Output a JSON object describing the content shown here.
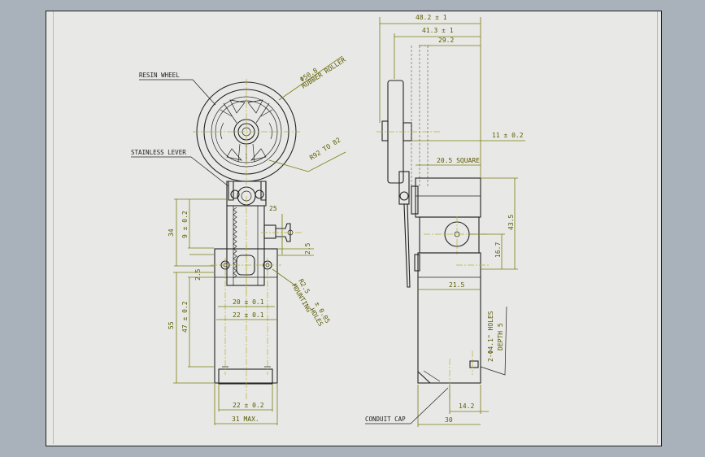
{
  "labels": {
    "resin_wheel": "RESIN WHEEL",
    "stainless_lever": "STAINLESS LEVER",
    "rubber_roller_1": "Φ50.8",
    "rubber_roller_2": "RUBBER ROLLER",
    "radius": "R92 TO 82",
    "mounting_holes_1": "R2.5",
    "mounting_holes_2": "MOUNTING",
    "mounting_holes_3": "± 0.05",
    "mounting_holes_4": "HOLES",
    "conduit_cap": "CONDUIT CAP",
    "holes_note_1": "2-Φ4.1\" HOLES",
    "holes_note_2": "DEPTH 5"
  },
  "dims_front": {
    "d34": "34",
    "d9": "9 ± 0.2",
    "d25a": "25",
    "d25b": "2.5",
    "d25c": "2.5",
    "d55": "55",
    "d47": "47 ± 0.2",
    "d20": "20 ± 0.1",
    "d22a": "22 ± 0.1",
    "d22b": "22 ± 0.2",
    "d31": "31 MAX."
  },
  "dims_side": {
    "d48": "48.2 ± 1",
    "d41": "41.3 ± 1",
    "d29": "29.2",
    "d11": "11 ± 0.2",
    "d20sq": "20.5 SQUARE",
    "d43": "43.5",
    "d16": "16.7",
    "d21": "21.5",
    "d14": "14.2",
    "d30": "30"
  },
  "colors": {
    "background": "#a9b1bb",
    "sheet": "#e8e9e6",
    "dimension": "#7a7a10",
    "outline": "#222222"
  }
}
